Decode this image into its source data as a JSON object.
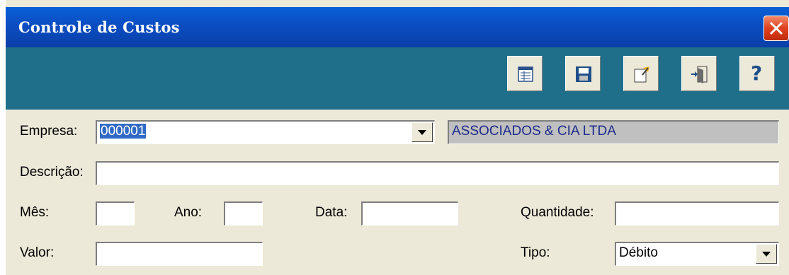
{
  "window": {
    "title": "Controle de Custos"
  },
  "toolbar": {
    "buttons": [
      "list-icon",
      "save-icon",
      "edit-icon",
      "exit-icon",
      "help-icon"
    ]
  },
  "form": {
    "empresa": {
      "label": "Empresa:",
      "value": "000001",
      "name": "ASSOCIADOS & CIA LTDA"
    },
    "descricao": {
      "label": "Descrição:",
      "value": ""
    },
    "mes": {
      "label": "Mês:",
      "value": ""
    },
    "ano": {
      "label": "Ano:",
      "value": ""
    },
    "data": {
      "label": "Data:",
      "value": ""
    },
    "quantidade": {
      "label": "Quantidade:",
      "value": ""
    },
    "valor": {
      "label": "Valor:",
      "value": ""
    },
    "tipo": {
      "label": "Tipo:",
      "value": "Débito"
    }
  },
  "help_glyph": "?"
}
